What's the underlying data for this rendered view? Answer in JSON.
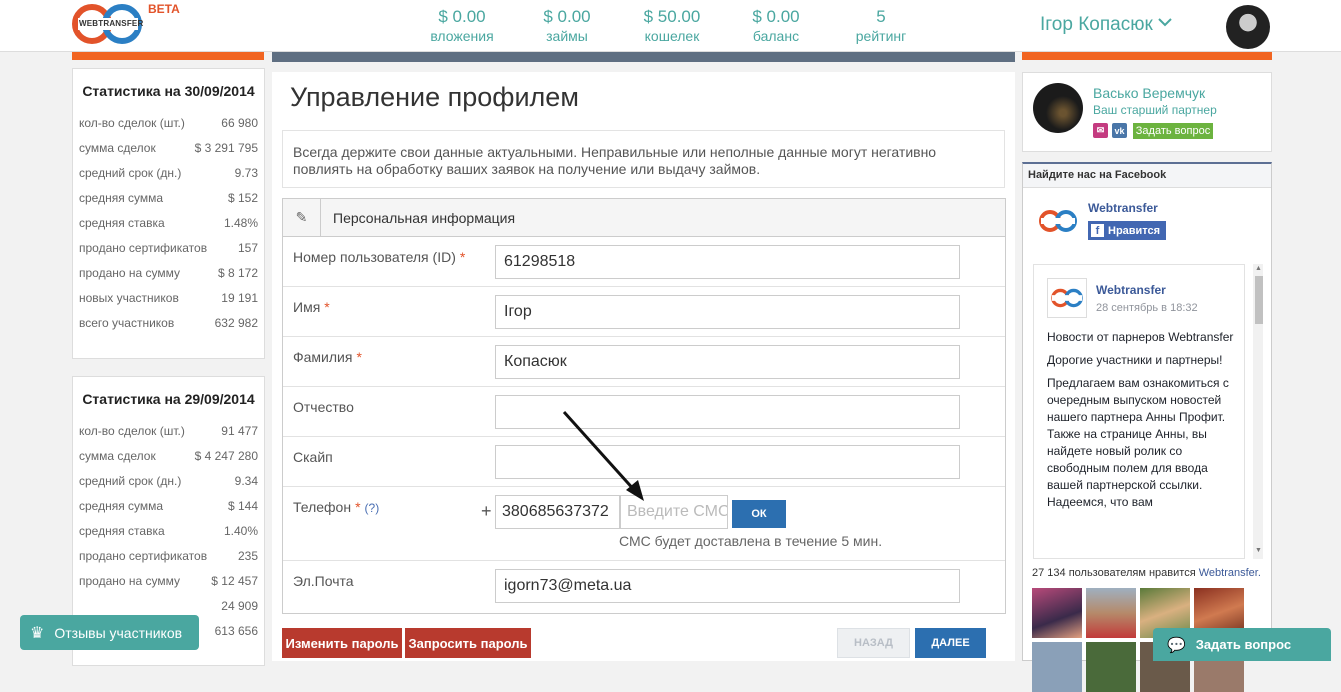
{
  "header": {
    "logo_text": "WEBTRANSFER",
    "beta": "BETA",
    "stats": [
      {
        "value": "$ 0.00",
        "label": "вложения"
      },
      {
        "value": "$ 0.00",
        "label": "займы"
      },
      {
        "value": "$ 50.00",
        "label": "кошелек"
      },
      {
        "value": "$ 0.00",
        "label": "баланс"
      },
      {
        "value": "5",
        "label": "рейтинг"
      }
    ],
    "username": "Ігор Копасюк"
  },
  "sidebar": {
    "boxes": [
      {
        "title": "Статистика на 30/09/2014",
        "rows": [
          {
            "label": "кол-во сделок (шт.)",
            "value": "66 980"
          },
          {
            "label": "сумма сделок",
            "value": "$ 3 291 795"
          },
          {
            "label": "средний срок (дн.)",
            "value": "9.73"
          },
          {
            "label": "средняя сумма",
            "value": "$ 152"
          },
          {
            "label": "средняя ставка",
            "value": "1.48%"
          },
          {
            "label": "продано сертификатов",
            "value": "157"
          },
          {
            "label": "продано на сумму",
            "value": "$ 8 172"
          },
          {
            "label": "новых участников",
            "value": "19 191"
          },
          {
            "label": "всего участников",
            "value": "632 982"
          }
        ]
      },
      {
        "title": "Статистика на 29/09/2014",
        "rows": [
          {
            "label": "кол-во сделок (шт.)",
            "value": "91 477"
          },
          {
            "label": "сумма сделок",
            "value": "$ 4 247 280"
          },
          {
            "label": "средний срок (дн.)",
            "value": "9.34"
          },
          {
            "label": "средняя сумма",
            "value": "$ 144"
          },
          {
            "label": "средняя ставка",
            "value": "1.40%"
          },
          {
            "label": "продано сертификатов",
            "value": "235"
          },
          {
            "label": "продано на сумму",
            "value": "$ 12 457"
          },
          {
            "label": "",
            "value": "24 909"
          },
          {
            "label": "",
            "value": "613 656"
          }
        ]
      }
    ]
  },
  "main": {
    "title": "Управление профилем",
    "notice": "Всегда держите свои данные актуальными. Неправильные или неполные данные могут негативно повлиять на обработку ваших заявок на получение или выдачу займов.",
    "section_title": "Персональная информация",
    "fields": {
      "id_label": "Номер пользователя (ID)",
      "id_value": "61298518",
      "name_label": "Имя",
      "name_value": "Ігор",
      "surname_label": "Фамилия",
      "surname_value": "Копасюк",
      "patronymic_label": "Отчество",
      "patronymic_value": "",
      "skype_label": "Скайп",
      "skype_value": "",
      "phone_label": "Телефон",
      "phone_help": "(?)",
      "phone_plus": "+",
      "phone_value": "380685637372",
      "sms_placeholder": "Введите СМС",
      "ok_label": "ОК",
      "sms_note": "СМС будет доставлена в течение 5 мин.",
      "email_label": "Эл.Почта",
      "email_value": "igorn73@meta.ua",
      "required_mark": "*"
    },
    "buttons": {
      "change_password": "Изменить пароль",
      "request_password": "Запросить пароль",
      "back": "НАЗАД",
      "next": "ДАЛЕЕ"
    }
  },
  "partner": {
    "name": "Васько Веремчук",
    "role": "Ваш старший партнер",
    "ask": "Задать вопрос"
  },
  "facebook": {
    "header": "Найдите нас на Facebook",
    "page_name": "Webtransfer",
    "like": "Нравится",
    "post_name": "Webtransfer",
    "post_date": "28 сентябрь в 18:32",
    "post_paragraphs": [
      "Новости от парнеров Webtransfer",
      "Дорогие участники и партнеры!",
      "Предлагаем вам ознакомиться с очередным выпуском новостей нашего партнера Анны Профит. Также на странице Анны, вы найдете новый ролик со свободным полем для ввода вашей партнерской ссылки. Надеемся, что вам"
    ],
    "likes_count": "27 134 пользователям нравится",
    "likes_link": "Webtransfer."
  },
  "floating": {
    "reviews": "Отзывы участников",
    "ask": "Задать вопрос"
  },
  "colors": {
    "accent": "#4aa7a0",
    "orange": "#f16522",
    "red_button": "#b83a2e",
    "blue_button": "#2c6fb0"
  }
}
